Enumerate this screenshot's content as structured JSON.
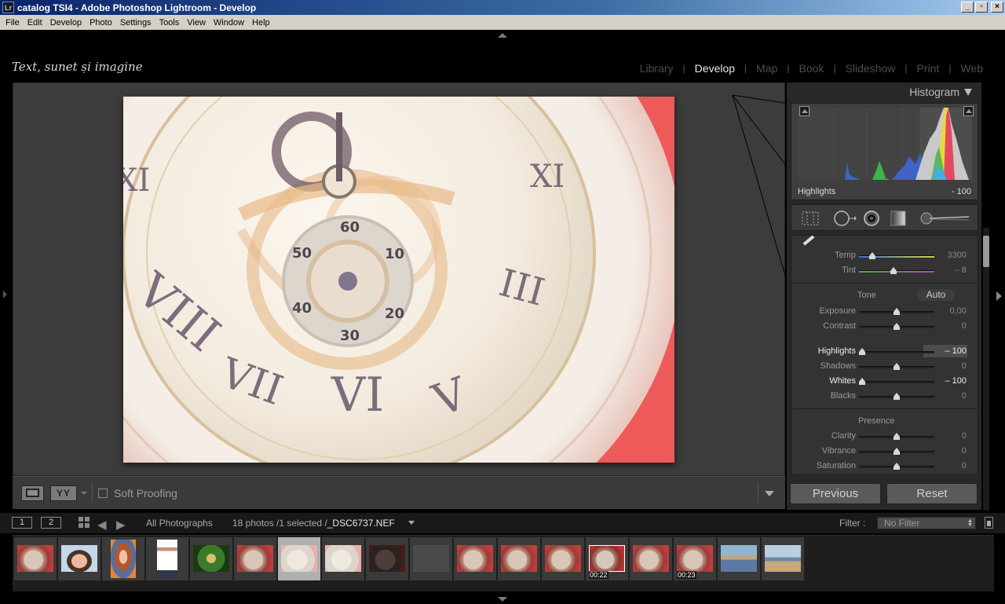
{
  "window": {
    "title": "catalog TSI4 - Adobe Photoshop Lightroom - Develop",
    "app_icon_text": "Lr",
    "controls": [
      "_",
      "▫",
      "×"
    ]
  },
  "menu": [
    "File",
    "Edit",
    "Develop",
    "Photo",
    "Settings",
    "Tools",
    "View",
    "Window",
    "Help"
  ],
  "identity_plate": "Text, sunet și imagine",
  "modules": [
    {
      "label": "Library",
      "active": false
    },
    {
      "label": "Develop",
      "active": true
    },
    {
      "label": "Map",
      "active": false
    },
    {
      "label": "Book",
      "active": false
    },
    {
      "label": "Slideshow",
      "active": false
    },
    {
      "label": "Print",
      "active": false
    },
    {
      "label": "Web",
      "active": false
    }
  ],
  "toolbar": {
    "compare_label": "YY",
    "soft_proofing_label": "Soft Proofing"
  },
  "histogram": {
    "title": "Histogram",
    "label": "Highlights",
    "value": "- 100"
  },
  "tools": [
    "crop-overlay-icon",
    "spot-removal-icon",
    "red-eye-icon",
    "graduated-filter-icon",
    "adjustment-brush-icon"
  ],
  "basic": {
    "wb": [
      {
        "label": "Temp",
        "value": "3300",
        "pos": 0.18,
        "colors": [
          "#3b6fd6",
          "#d8d23a"
        ]
      },
      {
        "label": "Tint",
        "value": "– 8",
        "pos": 0.46,
        "colors": [
          "#3ab63a",
          "#c23fc2"
        ]
      }
    ],
    "tone_title": "Tone",
    "auto_label": "Auto",
    "tone": [
      {
        "label": "Exposure",
        "value": "0,00",
        "pos": 0.5,
        "active": false
      },
      {
        "label": "Contrast",
        "value": "0",
        "pos": 0.5,
        "active": false
      },
      {
        "label": "Highlights",
        "value": "– 100",
        "pos": 0.04,
        "active": true,
        "boxed": true
      },
      {
        "label": "Shadows",
        "value": "0",
        "pos": 0.5,
        "active": false
      },
      {
        "label": "Whites",
        "value": "– 100",
        "pos": 0.04,
        "active": true
      },
      {
        "label": "Blacks",
        "value": "0",
        "pos": 0.5,
        "active": false
      }
    ],
    "presence_title": "Presence",
    "presence": [
      {
        "label": "Clarity",
        "value": "0",
        "pos": 0.5
      },
      {
        "label": "Vibrance",
        "value": "0",
        "pos": 0.5
      },
      {
        "label": "Saturation",
        "value": "0",
        "pos": 0.5
      }
    ]
  },
  "buttons": {
    "previous": "Previous",
    "reset": "Reset"
  },
  "filmstrip_header": {
    "screen1": "1",
    "screen2": "2",
    "source": "All Photographs",
    "count_prefix": "18 photos /1 selected /",
    "filename": "_DSC6737.NEF",
    "filter_label": "Filter :",
    "filter_value": "No Filter"
  },
  "filmstrip": [
    {
      "kind": "clock-red",
      "badge": ""
    },
    {
      "kind": "portrait-woman",
      "badge": ""
    },
    {
      "kind": "portrait-curly",
      "badge": ""
    },
    {
      "kind": "man-white",
      "badge": ""
    },
    {
      "kind": "green-window",
      "badge": ""
    },
    {
      "kind": "clock-red",
      "badge": ""
    },
    {
      "kind": "clock-faded",
      "badge": "",
      "selected": true
    },
    {
      "kind": "clock-faded",
      "badge": ""
    },
    {
      "kind": "clock-dark",
      "badge": ""
    },
    {
      "kind": "gray",
      "badge": ""
    },
    {
      "kind": "clock-red",
      "badge": ""
    },
    {
      "kind": "clock-red",
      "badge": ""
    },
    {
      "kind": "clock-red",
      "badge": ""
    },
    {
      "kind": "clock-video",
      "badge": "00:22"
    },
    {
      "kind": "clock-red",
      "badge": ""
    },
    {
      "kind": "clock-red",
      "badge": "00:23"
    },
    {
      "kind": "coast",
      "badge": ""
    },
    {
      "kind": "beach",
      "badge": ""
    }
  ]
}
